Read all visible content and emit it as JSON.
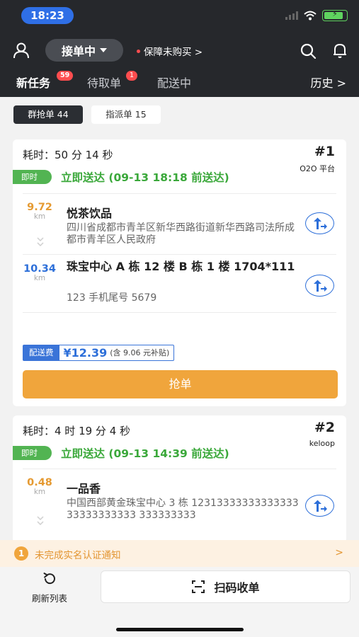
{
  "status_bar": {
    "time": "18:23"
  },
  "header": {
    "status_label": "接单中",
    "insurance_label": "保障未购买 >",
    "tabs": [
      {
        "label": "新任务",
        "badge": "59"
      },
      {
        "label": "待取单",
        "badge": "1"
      },
      {
        "label": "配送中"
      }
    ],
    "history_label": "历史 >"
  },
  "filters": [
    {
      "label": "群抢单 44"
    },
    {
      "label": "指派单 15"
    }
  ],
  "orders": [
    {
      "elapsed": "耗时：50 分 14 秒",
      "rank": "#1",
      "platform": "O2O 平台",
      "tag": "即时",
      "delivery_text": "立即送达 (09-13 18:18 前送达)",
      "pickup": {
        "distance": "9.72",
        "unit": "km",
        "name": "悦茶饮品",
        "address": "四川省成都市青羊区新华西路街道新华西路司法所成都市青羊区人民政府"
      },
      "dropoff": {
        "distance": "10.34",
        "unit": "km",
        "title": "珠宝中心 A 栋 12 楼 B 栋 1 楼 1704*111",
        "phone": "123 手机尾号 5679"
      },
      "fee_label": "配送费",
      "fee_amount": "¥12.39",
      "fee_subsidy": "(含 9.06 元补贴)",
      "grab_label": "抢单"
    },
    {
      "elapsed": "耗时：4 时 19 分 4 秒",
      "rank": "#2",
      "platform": "keloop",
      "tag": "即时",
      "delivery_text": "立即送达 (09-13 14:39 前送达)",
      "pickup": {
        "distance": "0.48",
        "unit": "km",
        "name": "一品香",
        "address": "中国西部黄金珠宝中心 3 栋 1231333333333333333333333333 333333333"
      }
    }
  ],
  "notice": {
    "icon": "1",
    "text": "未完成实名认证通知",
    "arrow": ">"
  },
  "bottom_bar": {
    "refresh_label": "刷新列表",
    "scan_label": "扫码收单"
  },
  "colors": {
    "header_bg": "#26282c",
    "accent_orange": "#f0a53c",
    "accent_green": "#3aa83a",
    "accent_blue": "#2d6fd9",
    "badge_red": "#ff4d4f"
  },
  "icons": [
    "user-icon",
    "chevron-down-icon",
    "search-icon",
    "bell-icon",
    "navigate-icon",
    "refresh-icon",
    "scan-icon",
    "wifi-icon",
    "battery-icon"
  ]
}
